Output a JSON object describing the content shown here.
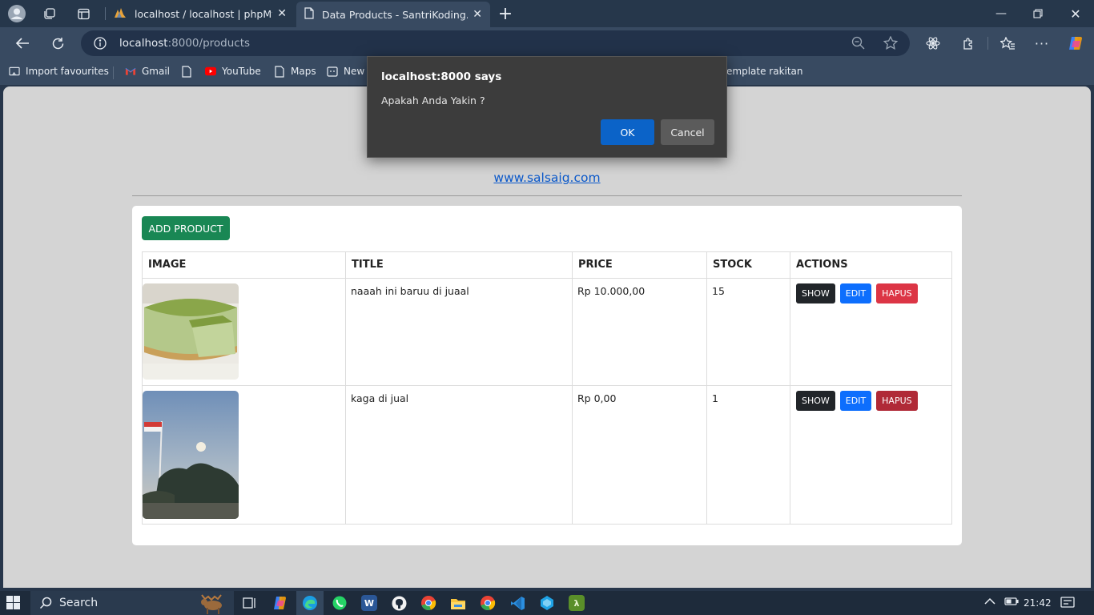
{
  "browser": {
    "tabs": [
      {
        "title": "localhost / localhost | phpMyAdmin",
        "active": false
      },
      {
        "title": "Data Products - SantriKoding.com",
        "active": true
      }
    ],
    "url_host": "localhost",
    "url_rest": ":8000/products",
    "bookmarks": [
      "Import favourites",
      "Gmail",
      "YouTube",
      "Maps",
      "New t",
      "emplate rakitan"
    ]
  },
  "dialog": {
    "title": "localhost:8000 says",
    "message": "Apakah Anda Yakin ?",
    "ok_label": "OK",
    "cancel_label": "Cancel"
  },
  "page": {
    "site_link": "www.salsaig.com",
    "add_button": "ADD PRODUCT",
    "columns": [
      "IMAGE",
      "TITLE",
      "PRICE",
      "STOCK",
      "ACTIONS"
    ],
    "rows": [
      {
        "title": "naaah ini baruu di juaal",
        "price": "Rp 10.000,00",
        "stock": "15",
        "image": "matcha-cheesecake"
      },
      {
        "title": "kaga di jual",
        "price": "Rp 0,00",
        "stock": "1",
        "image": "sky-flag-photo"
      }
    ],
    "actions": {
      "show": "SHOW",
      "edit": "EDIT",
      "delete": "HAPUS"
    }
  },
  "taskbar": {
    "search_label": "Search",
    "time": "21:42"
  },
  "colors": {
    "add_button": "#198754",
    "show_button": "#212529",
    "edit_button": "#0d6efd",
    "delete_button": "#dc3545",
    "dialog_ok": "#0b63c8"
  }
}
